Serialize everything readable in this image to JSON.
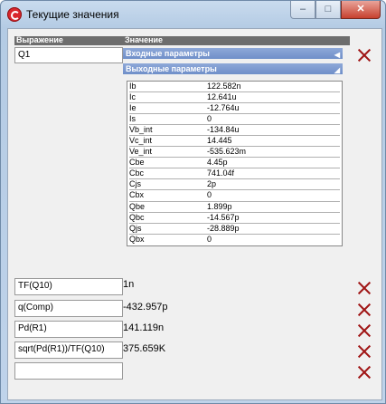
{
  "window": {
    "title": "Текущие значения",
    "buttons": [
      "–",
      "□",
      "✕"
    ]
  },
  "header": {
    "expr_label": "Выражение",
    "value_label": "Значение"
  },
  "q1": {
    "expression": "Q1",
    "input_section": "Входные параметры",
    "output_section": "Выходные параметры",
    "params": [
      {
        "name": "Ib",
        "value": "122.582n"
      },
      {
        "name": "Ic",
        "value": "12.641u"
      },
      {
        "name": "Ie",
        "value": "-12.764u"
      },
      {
        "name": "Is",
        "value": "0"
      },
      {
        "name": "Vb_int",
        "value": "-134.84u"
      },
      {
        "name": "Vc_int",
        "value": "14.445"
      },
      {
        "name": "Ve_int",
        "value": "-535.623m"
      },
      {
        "name": "Cbe",
        "value": "4.45p"
      },
      {
        "name": "Cbc",
        "value": "741.04f"
      },
      {
        "name": "Cjs",
        "value": "2p"
      },
      {
        "name": "Cbx",
        "value": "0"
      },
      {
        "name": "Qbe",
        "value": "1.899p"
      },
      {
        "name": "Qbc",
        "value": "-14.567p"
      },
      {
        "name": "Qjs",
        "value": "-28.889p"
      },
      {
        "name": "Qbx",
        "value": "0"
      }
    ]
  },
  "rows": [
    {
      "expression": "TF(Q10)",
      "value": "1n"
    },
    {
      "expression": "q(Comp)",
      "value": "-432.957p"
    },
    {
      "expression": "Pd(R1)",
      "value": "141.119n"
    },
    {
      "expression": "sqrt(Pd(R1))/TF(Q10)",
      "value": "375.659K"
    },
    {
      "expression": "",
      "value": ""
    }
  ]
}
